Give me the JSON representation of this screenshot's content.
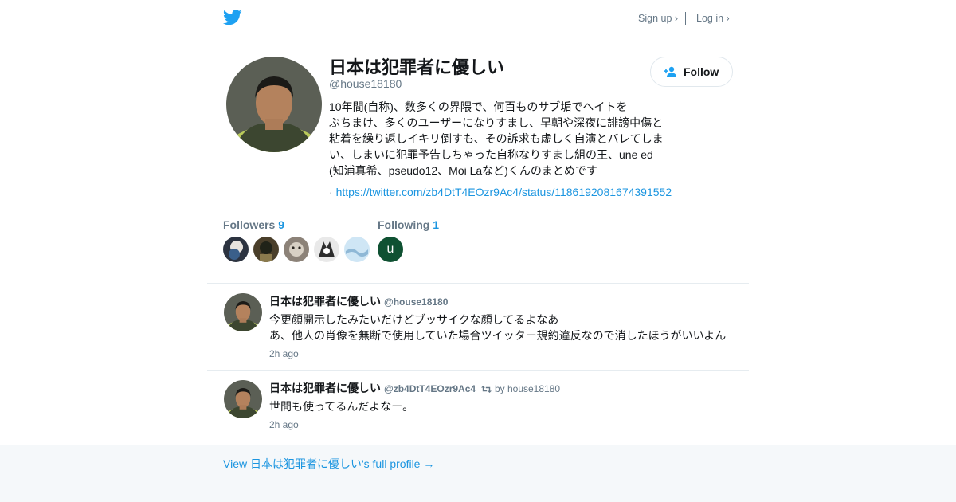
{
  "colors": {
    "brand": "#1da1f2",
    "link": "#1b95e0",
    "muted": "#657786",
    "text": "#14171a",
    "border": "#e6ecf0",
    "footer_bg": "#f5f8fa"
  },
  "header": {
    "logo_icon": "twitter-bird-icon",
    "signup_label": "Sign up ›",
    "login_label": "Log in ›"
  },
  "profile": {
    "name": "日本は犯罪者に優しい",
    "handle": "@house18180",
    "bio_lines": [
      "10年間(自称)、数多くの界隈で、何百ものサブ垢でヘイトを",
      "ぶちまけ、多くのユーザーになりすまし、早朝や深夜に誹謗中傷と",
      "粘着を繰り返しイキリ倒すも、その訴求も虚しく自演とバレてしま",
      "い、しまいに犯罪予告しちゃった自称なりすまし組の王、une ed",
      "(知浦真希、pseudo12、Moi Laなど)くんのまとめです"
    ],
    "link_prefix": "·",
    "link": "https://twitter.com/zb4DtT4EOzr9Ac4/status/1186192081674391552",
    "follow_label": "Follow",
    "follow_icon": "add-user-icon",
    "followers_label": "Followers",
    "followers_count": "9",
    "following_label": "Following",
    "following_count": "1",
    "following_initial": "u"
  },
  "tweets": [
    {
      "name": "日本は犯罪者に優しい",
      "handle": "@house18180",
      "lines": [
        "今更顔開示したみたいだけどブッサイクな顔してるよなあ",
        "あ、他人の肖像を無断で使用していた場合ツイッター規約違反なので消したほうがいいよん"
      ],
      "time": "2h ago"
    },
    {
      "name": "日本は犯罪者に優しい",
      "handle": "@zb4DtT4EOzr9Ac4",
      "retweet_icon": "retweet-icon",
      "retweeted_by": "by house18180",
      "lines": [
        "世間も使ってるんだよなー。"
      ],
      "time": "2h ago"
    }
  ],
  "footer": {
    "full_profile_link": "View 日本は犯罪者に優しい's full profile →"
  }
}
